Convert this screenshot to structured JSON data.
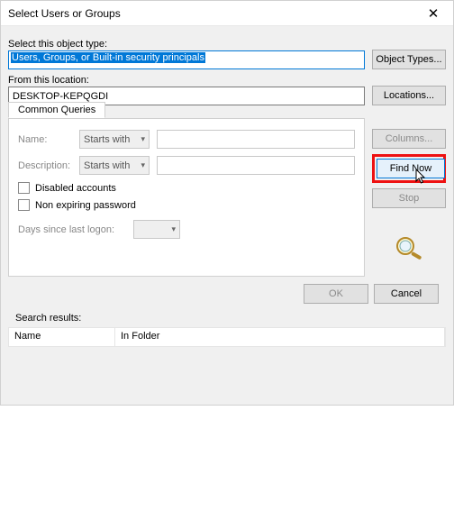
{
  "title": "Select Users or Groups",
  "close_icon": "✕",
  "labels": {
    "object_type": "Select this object type:",
    "location": "From this location:",
    "search_results": "Search results:"
  },
  "fields": {
    "object_type_value": "Users, Groups, or Built-in security principals",
    "location_value": "DESKTOP-KEPQGDI"
  },
  "buttons": {
    "object_types": "Object Types...",
    "locations": "Locations...",
    "columns": "Columns...",
    "find_now": "Find Now",
    "stop": "Stop",
    "ok": "OK",
    "cancel": "Cancel"
  },
  "tab": {
    "label": "Common Queries"
  },
  "queries": {
    "name_label": "Name:",
    "desc_label": "Description:",
    "starts_with": "Starts with",
    "disabled_accounts": "Disabled accounts",
    "non_expiring": "Non expiring password",
    "days_since": "Days since last logon:"
  },
  "results": {
    "col_name": "Name",
    "col_folder": "In Folder"
  }
}
